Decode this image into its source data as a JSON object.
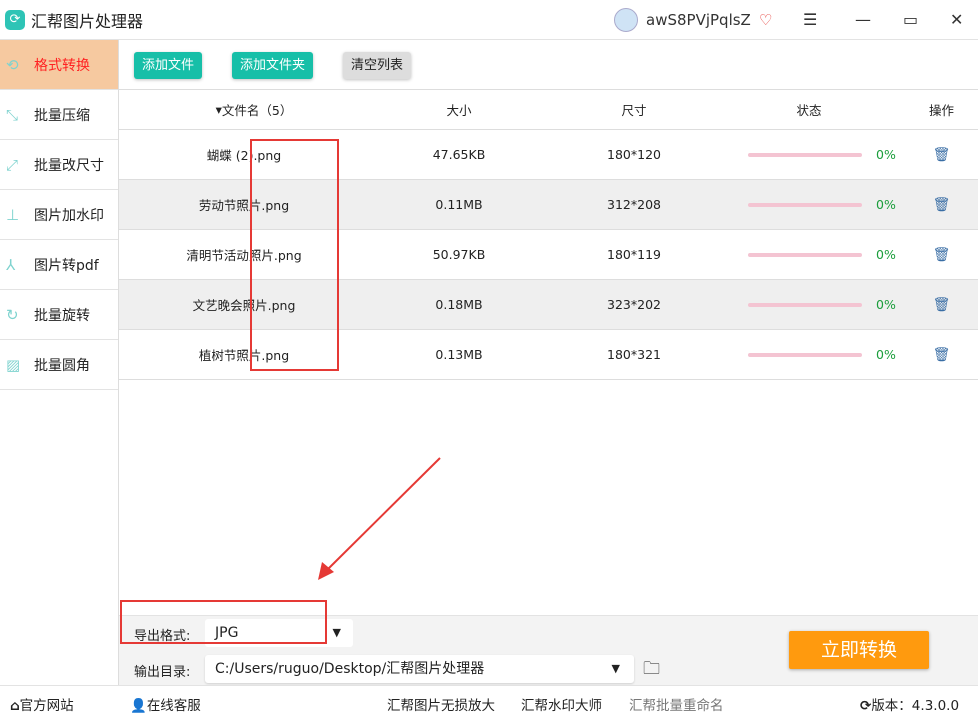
{
  "app": {
    "title": "汇帮图片处理器",
    "username": "awS8PVjPqlsZ"
  },
  "sidebar": {
    "items": [
      {
        "label": "格式转换"
      },
      {
        "label": "批量压缩"
      },
      {
        "label": "批量改尺寸"
      },
      {
        "label": "图片加水印"
      },
      {
        "label": "图片转pdf"
      },
      {
        "label": "批量旋转"
      },
      {
        "label": "批量圆角"
      }
    ]
  },
  "toolbar": {
    "add_file": "添加文件",
    "add_folder": "添加文件夹",
    "clear": "清空列表"
  },
  "table": {
    "headers": {
      "name": "文件名（5）",
      "size": "大小",
      "dims": "尺寸",
      "status": "状态",
      "action": "操作"
    },
    "rows": [
      {
        "name": "蝴蝶 (2).png",
        "size": "47.65KB",
        "dims": "180*120",
        "progress": "0%"
      },
      {
        "name": "劳动节照片.png",
        "size": "0.11MB",
        "dims": "312*208",
        "progress": "0%"
      },
      {
        "name": "清明节活动照片.png",
        "size": "50.97KB",
        "dims": "180*119",
        "progress": "0%"
      },
      {
        "name": "文艺晚会照片.png",
        "size": "0.18MB",
        "dims": "323*202",
        "progress": "0%"
      },
      {
        "name": "植树节照片.png",
        "size": "0.13MB",
        "dims": "180*321",
        "progress": "0%"
      }
    ]
  },
  "output": {
    "format_label": "导出格式:",
    "format_value": "JPG",
    "dir_label": "输出目录:",
    "dir_value": "C:/Users/ruguo/Desktop/汇帮图片处理器",
    "convert": "立即转换"
  },
  "footer": {
    "website": "官方网站",
    "support": "在线客服",
    "link1": "汇帮图片无损放大",
    "link2": "汇帮水印大师",
    "link3": "汇帮批量重命名",
    "version": "版本：4.3.0.0"
  }
}
